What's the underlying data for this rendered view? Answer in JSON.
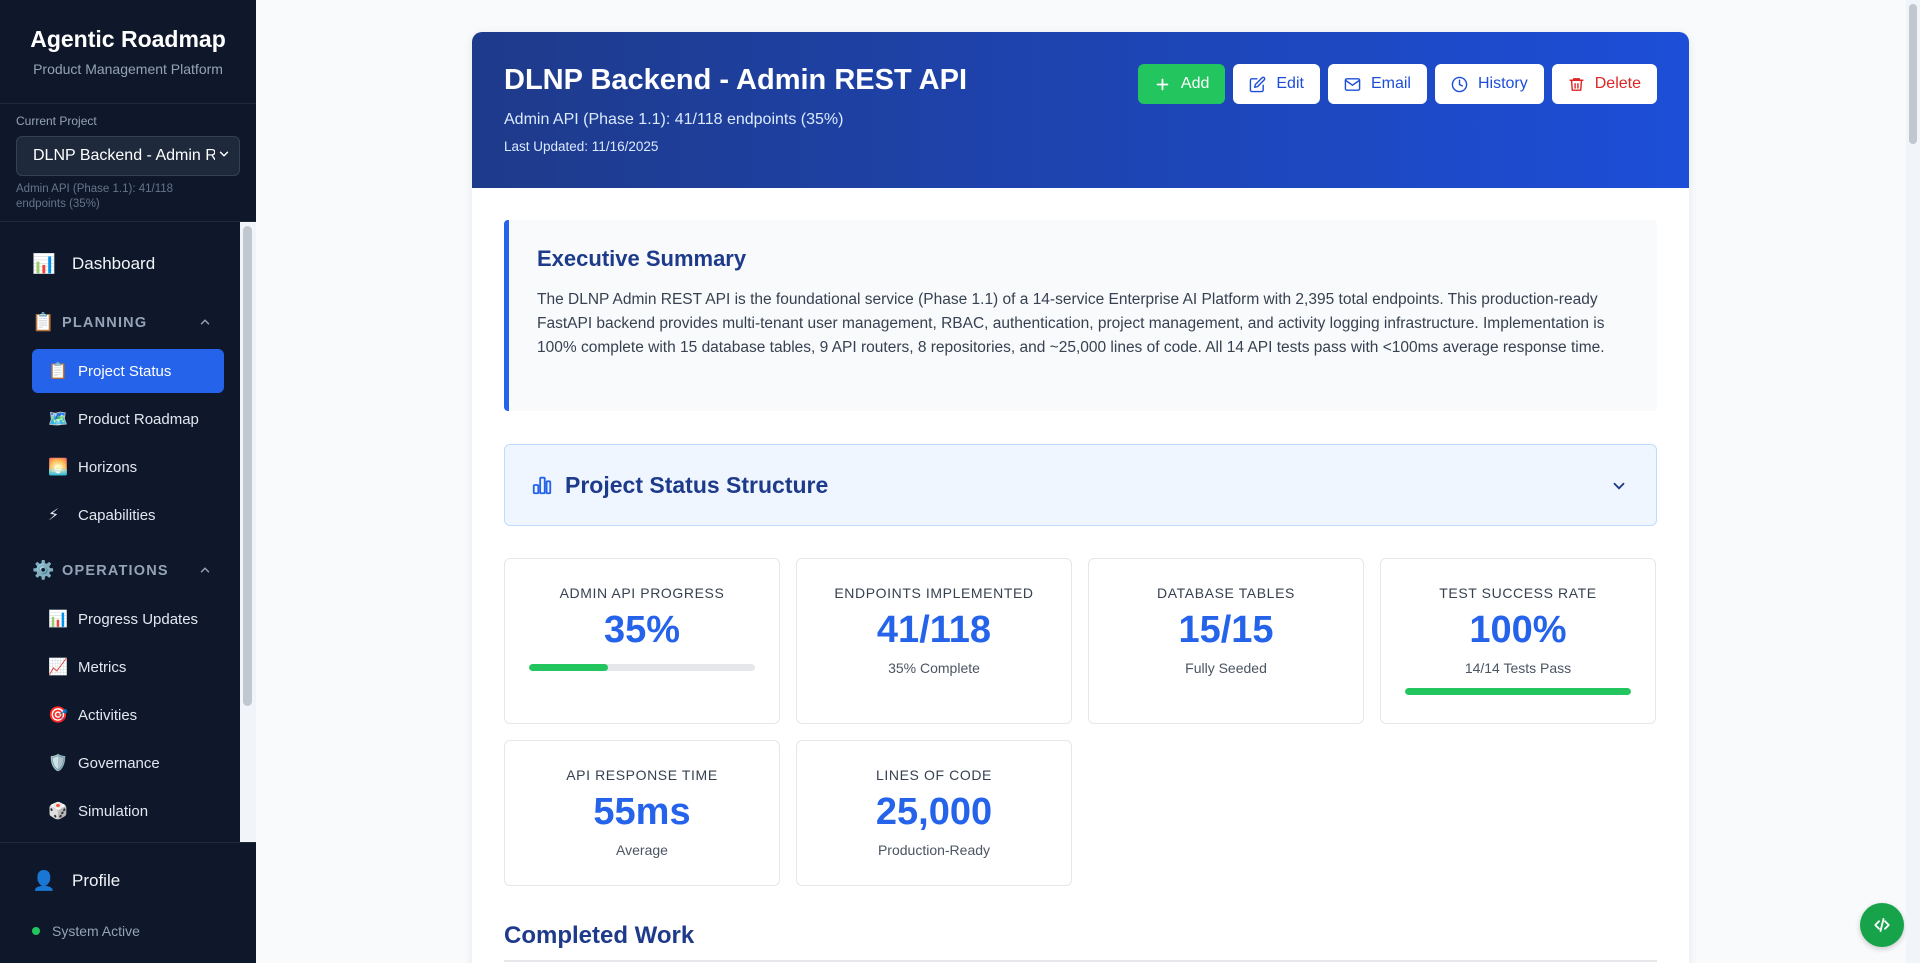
{
  "sidebar": {
    "brand_title": "Agentic Roadmap",
    "brand_subtitle": "Product Management Platform",
    "current_project_label": "Current Project",
    "current_project_value": "DLNP Backend - Admin REST API",
    "current_project_desc": "Admin API (Phase 1.1): 41/118 endpoints (35%)",
    "dashboard": {
      "icon": "📊",
      "label": "Dashboard"
    },
    "planning": {
      "icon": "📋",
      "label": "PLANNING",
      "items": [
        {
          "icon": "📋",
          "label": "Project Status",
          "active": true
        },
        {
          "icon": "🗺️",
          "label": "Product Roadmap"
        },
        {
          "icon": "🌅",
          "label": "Horizons"
        },
        {
          "icon": "⚡",
          "label": "Capabilities"
        }
      ]
    },
    "operations": {
      "icon": "⚙️",
      "label": "OPERATIONS",
      "items": [
        {
          "icon": "📊",
          "label": "Progress Updates"
        },
        {
          "icon": "📈",
          "label": "Metrics"
        },
        {
          "icon": "🎯",
          "label": "Activities"
        },
        {
          "icon": "🛡️",
          "label": "Governance"
        },
        {
          "icon": "🎲",
          "label": "Simulation"
        }
      ]
    },
    "profile": {
      "icon": "👤",
      "label": "Profile"
    },
    "system_status": "System Active"
  },
  "header": {
    "title": "DLNP Backend - Admin REST API",
    "subtitle": "Admin API (Phase 1.1): 41/118 endpoints (35%)",
    "last_updated": "Last Updated: 11/16/2025",
    "actions": {
      "add": "Add",
      "edit": "Edit",
      "email": "Email",
      "history": "History",
      "delete": "Delete"
    }
  },
  "executive_summary": {
    "title": "Executive Summary",
    "body": "The DLNP Admin REST API is the foundational service (Phase 1.1) of a 14-service Enterprise AI Platform with 2,395 total endpoints. This production-ready FastAPI backend provides multi-tenant user management, RBAC, authentication, project management, and activity logging infrastructure. Implementation is 100% complete with 15 database tables, 9 API routers, 8 repositories, and ~25,000 lines of code. All 14 API tests pass with <100ms average response time."
  },
  "structure": {
    "title": "Project Status Structure"
  },
  "metrics": [
    {
      "label": "ADMIN API PROGRESS",
      "value": "35%",
      "sub": "",
      "progress": 0.35
    },
    {
      "label": "ENDPOINTS IMPLEMENTED",
      "value": "41/118",
      "sub": "35% Complete"
    },
    {
      "label": "DATABASE TABLES",
      "value": "15/15",
      "sub": "Fully Seeded"
    },
    {
      "label": "TEST SUCCESS RATE",
      "value": "100%",
      "sub": "14/14 Tests Pass",
      "progress": 1.0
    },
    {
      "label": "API RESPONSE TIME",
      "value": "55ms",
      "sub": "Average"
    },
    {
      "label": "LINES OF CODE",
      "value": "25,000",
      "sub": "Production-Ready"
    }
  ],
  "completed_work": {
    "title": "Completed Work"
  },
  "colors": {
    "sidebar_bg": "#0f172a",
    "accent": "#2563eb",
    "hero_start": "#1e3a8a",
    "success": "#22c55e",
    "danger": "#dc2626"
  }
}
